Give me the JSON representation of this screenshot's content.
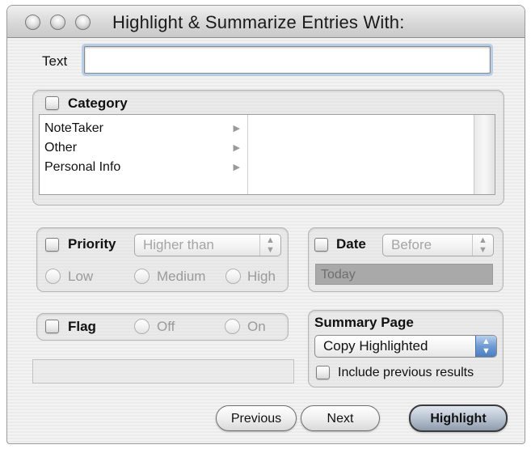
{
  "window": {
    "title": "Highlight & Summarize Entries With:"
  },
  "text": {
    "label": "Text",
    "value": ""
  },
  "category": {
    "label": "Category",
    "items": [
      {
        "label": "NoteTaker"
      },
      {
        "label": "Other"
      },
      {
        "label": "Personal Info"
      }
    ]
  },
  "priority": {
    "label": "Priority",
    "operator": "Higher than",
    "options": [
      "Low",
      "Medium",
      "High"
    ]
  },
  "date": {
    "label": "Date",
    "operator": "Before",
    "value": "Today"
  },
  "flag": {
    "label": "Flag",
    "options": [
      "Off",
      "On"
    ]
  },
  "summary": {
    "label": "Summary Page",
    "selected": "Copy Highlighted",
    "include_label": "Include previous results"
  },
  "buttons": {
    "previous": "Previous",
    "next": "Next",
    "highlight": "Highlight"
  },
  "icons": {
    "stepper": "⬍",
    "disclosure": "▶",
    "arrow_up": "▲",
    "arrow_down": "▼"
  }
}
